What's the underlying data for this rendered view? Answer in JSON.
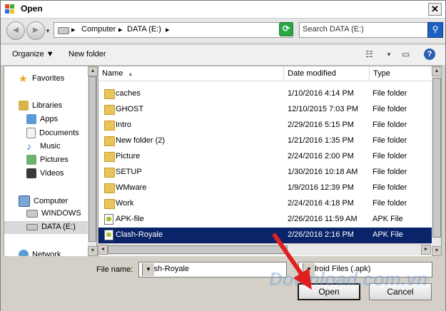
{
  "window": {
    "title": "Open",
    "close_glyph": "✕"
  },
  "navigation": {
    "back_glyph": "◄",
    "forward_glyph": "►",
    "address": {
      "crumbs": [
        "Computer",
        "DATA (E:)"
      ],
      "separator": "▸"
    },
    "search_placeholder": "Search DATA (E:)"
  },
  "toolbar": {
    "organize": "Organize",
    "new_folder": "New folder"
  },
  "sidebar": {
    "items": [
      {
        "label": "Favorites",
        "icon": "star-icon"
      },
      {
        "label": "Libraries",
        "icon": "libraries-icon"
      },
      {
        "label": "Apps",
        "icon": "apps-icon"
      },
      {
        "label": "Documents",
        "icon": "documents-icon"
      },
      {
        "label": "Music",
        "icon": "music-icon"
      },
      {
        "label": "Pictures",
        "icon": "pictures-icon"
      },
      {
        "label": "Videos",
        "icon": "videos-icon"
      },
      {
        "label": "Computer",
        "icon": "computer-icon"
      },
      {
        "label": "WINDOWS",
        "icon": "windows-drive-icon"
      },
      {
        "label": "DATA (E:)",
        "icon": "drive-icon"
      },
      {
        "label": "Network",
        "icon": "network-icon"
      }
    ]
  },
  "file_list": {
    "columns": [
      "Name",
      "Date modified",
      "Type"
    ],
    "rows": [
      {
        "name": "caches",
        "date": "1/10/2016 4:14 PM",
        "type": "File folder",
        "icon": "folder-icon"
      },
      {
        "name": "GHOST",
        "date": "12/10/2015 7:03 PM",
        "type": "File folder",
        "icon": "folder-icon"
      },
      {
        "name": "Intro",
        "date": "2/29/2016 5:15 PM",
        "type": "File folder",
        "icon": "folder-icon"
      },
      {
        "name": "New folder (2)",
        "date": "1/21/2016 1:35 PM",
        "type": "File folder",
        "icon": "folder-icon"
      },
      {
        "name": "Picture",
        "date": "2/24/2016 2:00 PM",
        "type": "File folder",
        "icon": "folder-icon"
      },
      {
        "name": "SETUP",
        "date": "1/30/2016 10:18 AM",
        "type": "File folder",
        "icon": "folder-icon"
      },
      {
        "name": "WMware",
        "date": "1/9/2016 12:39 PM",
        "type": "File folder",
        "icon": "folder-icon"
      },
      {
        "name": "Work",
        "date": "2/24/2016 4:18 PM",
        "type": "File folder",
        "icon": "folder-icon"
      },
      {
        "name": "APK-file",
        "date": "2/26/2016 11:59 AM",
        "type": "APK File",
        "icon": "apk-file-icon"
      },
      {
        "name": "Clash-Royale",
        "date": "2/26/2016 2:16 PM",
        "type": "APK File",
        "icon": "apk-file-icon"
      }
    ]
  },
  "bottom": {
    "file_name_label": "File name:",
    "file_name_value": "Clash-Royale",
    "filter_value": "Android Files (.apk)",
    "open_label": "Open",
    "cancel_label": "Cancel"
  },
  "watermark": "Download.com.vn",
  "colors": {
    "selection": "#0a246a",
    "arrow": "#e02020",
    "folder": "#e9c456",
    "accent": "#1d5fc1"
  }
}
